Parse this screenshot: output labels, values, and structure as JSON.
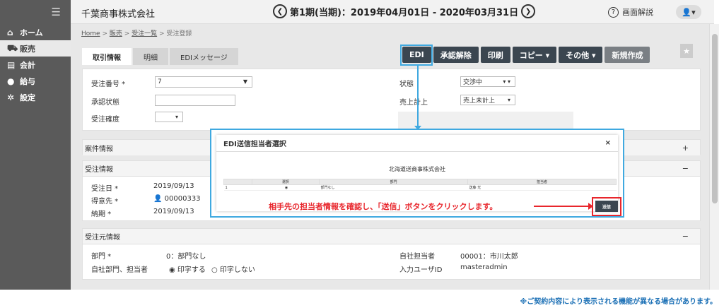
{
  "sidebar": {
    "items": [
      {
        "label": "ホーム",
        "icon": "home-icon",
        "glyph": "⌂"
      },
      {
        "label": "販売",
        "icon": "cart-icon",
        "glyph": "🛒"
      },
      {
        "label": "会計",
        "icon": "calculator-icon",
        "glyph": "▤"
      },
      {
        "label": "給与",
        "icon": "money-bag-icon",
        "glyph": "●"
      },
      {
        "label": "設定",
        "icon": "gear-icon",
        "glyph": "✲"
      }
    ]
  },
  "header": {
    "company": "千葉商事株式会社",
    "period": "第1期(当期)：2019年04月01日 - 2020年03月31日",
    "help_label": "画面解説"
  },
  "breadcrumb": {
    "home": "Home",
    "sales": "販売",
    "order_list": "受注一覧",
    "current": "受注登録"
  },
  "tabs": [
    "取引情報",
    "明細",
    "EDIメッセージ"
  ],
  "toolbar": {
    "edi": "EDI",
    "unapprove": "承認解除",
    "print": "印刷",
    "copy": "コピー ▾",
    "other": "その他 ▾",
    "new": "新規作成"
  },
  "order_form": {
    "order_no_label": "受注番号 *",
    "order_no_value": "7",
    "approval_label": "承認状態",
    "confirm_label": "受注確度",
    "status_label": "状態",
    "status_value": "交渉中",
    "sales_label": "売上計上",
    "sales_value": "売上未計上"
  },
  "project_panel": {
    "title": "案件情報",
    "toggle": "+"
  },
  "order_panel": {
    "title": "受注情報",
    "toggle": "−",
    "date_label": "受注日 *",
    "date_value": "2019/09/13",
    "customer_label": "得意先 *",
    "customer_value": "00000333",
    "due_label": "納期 *",
    "due_value": "2019/09/13"
  },
  "source_panel": {
    "title": "受注元情報",
    "toggle": "−",
    "dept_label": "部門 *",
    "dept_value": "0：部門なし",
    "own_dept_label": "自社部門、担当者",
    "print_yes": "◉ 印字する",
    "print_no": "○ 印字しない",
    "own_person_label": "自社担当者",
    "own_person_value": "00001：市川太郎",
    "input_user_label": "入力ユーザID",
    "input_user_value": "masteradmin"
  },
  "modal": {
    "title": "EDI送信担当者選択",
    "close": "×",
    "company": "北海道送商事株式会社",
    "columns": [
      "選択",
      "部門",
      "担当者"
    ],
    "rows": [
      {
        "no": "1",
        "select": "◉",
        "dept": "部門なし",
        "person": "送藤 光"
      }
    ],
    "instruction": "相手先の担当者情報を確認し、「送信」ボタンをクリックします。",
    "send_label": "送信"
  },
  "footnote": "※ご契約内容により表示される機能が異なる場合があります。",
  "colors": {
    "sidebar": "#5a5a5a",
    "button": "#3b4650",
    "highlight_blue": "#3fa9e0",
    "highlight_red": "#e8262c",
    "footnote": "#1a6fb5"
  }
}
